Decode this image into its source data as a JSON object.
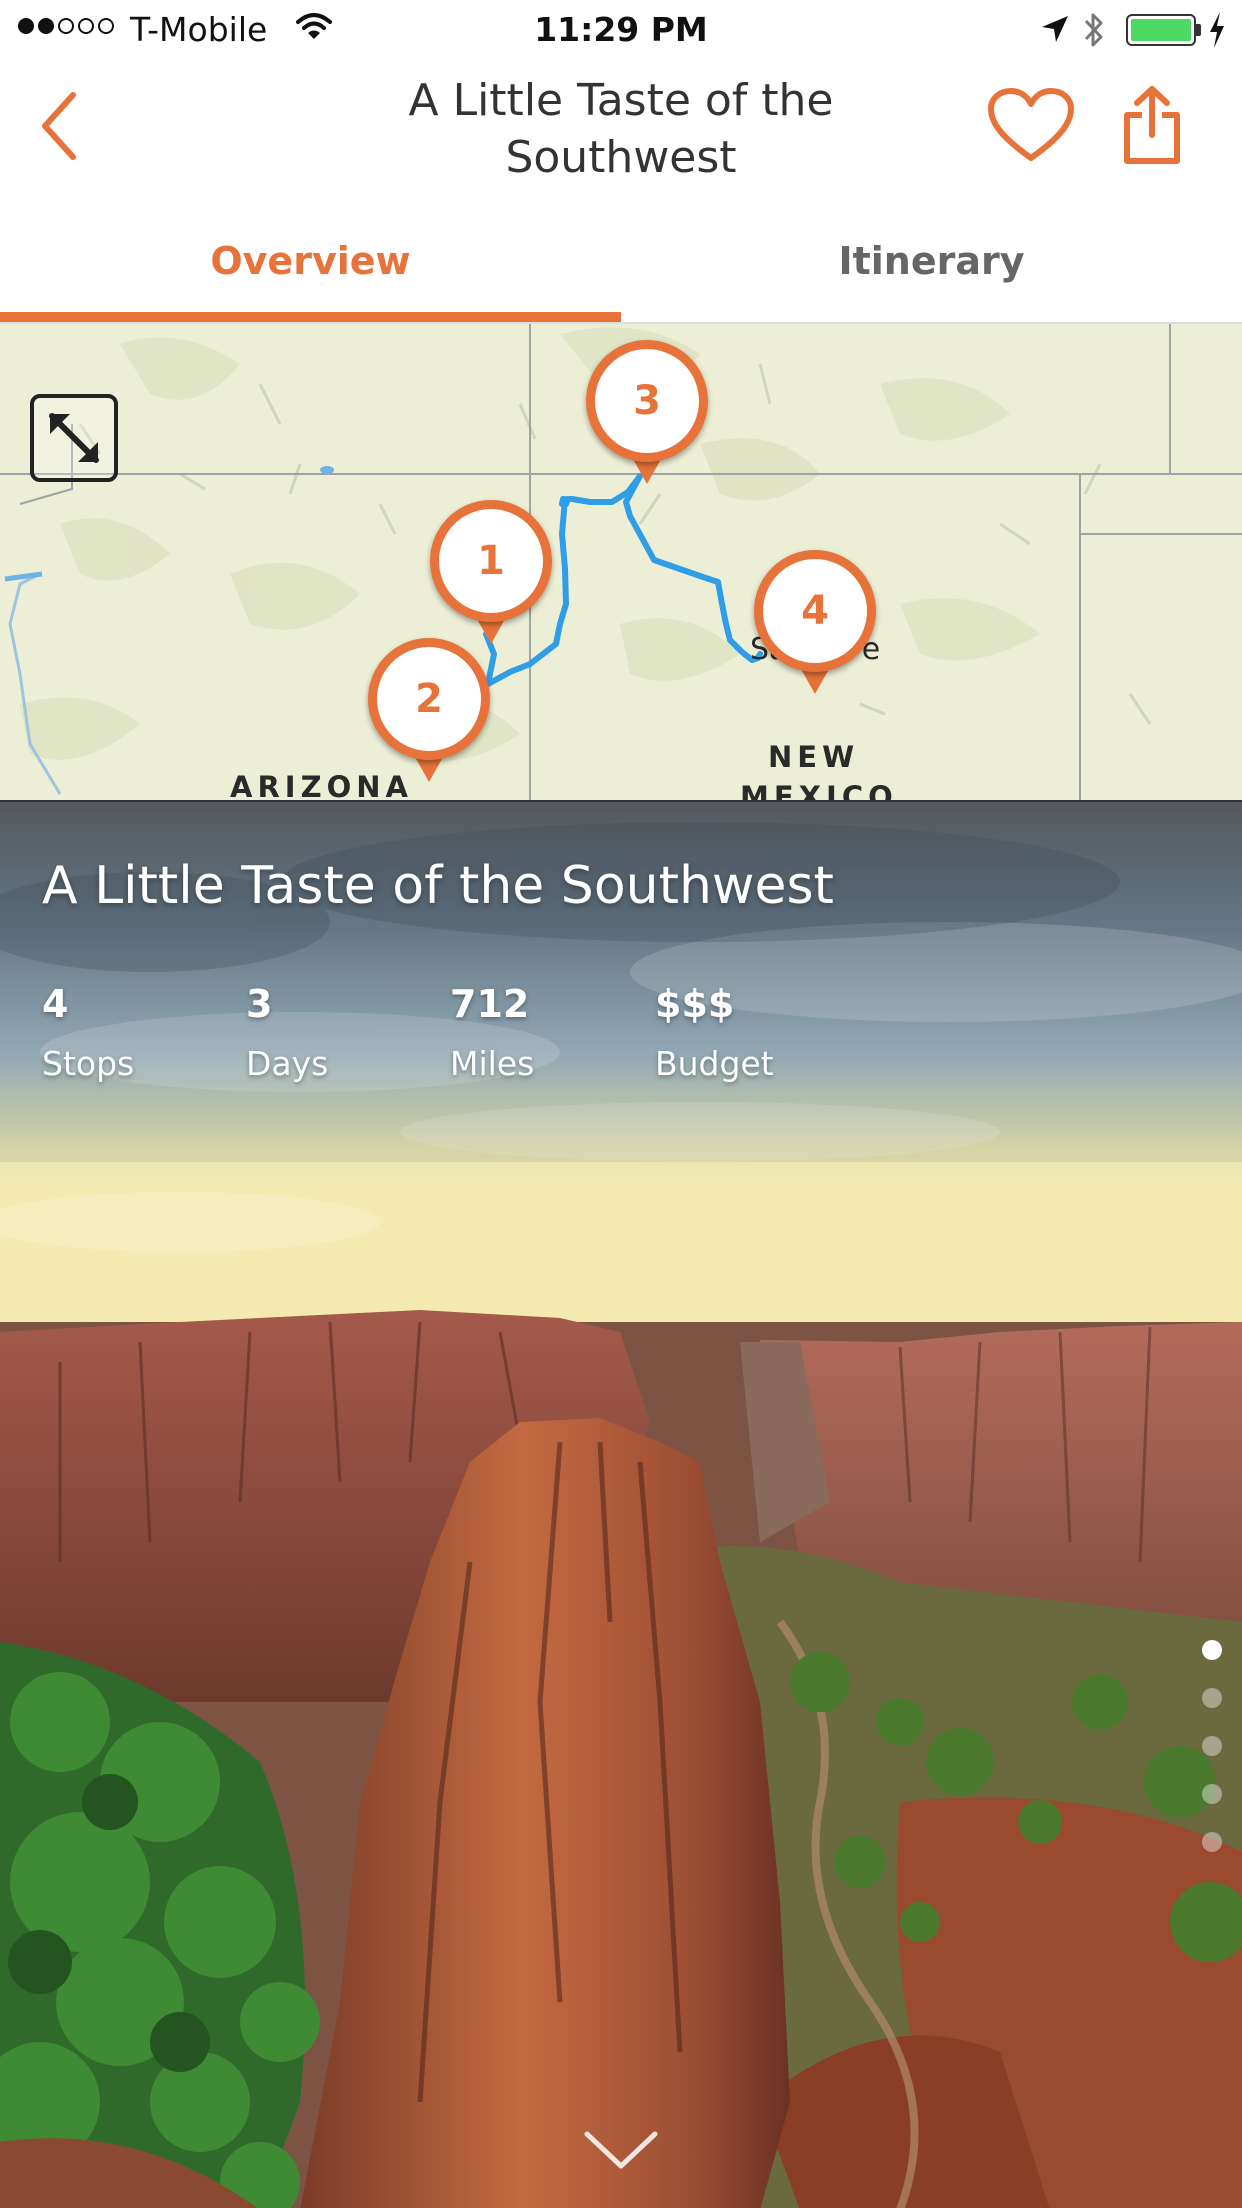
{
  "status_bar": {
    "carrier": "T-Mobile",
    "time": "11:29 PM",
    "signal_dots_filled": 2,
    "signal_dots_total": 5,
    "battery_level": 1.0
  },
  "nav": {
    "title": "A Little Taste of the Southwest",
    "back_icon": "chevron-left-icon",
    "favorite_icon": "heart-icon",
    "share_icon": "share-icon"
  },
  "tabs": [
    {
      "label": "Overview",
      "active": true
    },
    {
      "label": "Itinerary",
      "active": false
    }
  ],
  "map": {
    "labels": [
      "ARIZONA",
      "NEW",
      "MEXICO",
      "Santa Fe"
    ],
    "stops": [
      "1",
      "2",
      "3",
      "4"
    ],
    "route_color": "#2f9ee6",
    "expand_icon": "expand-icon"
  },
  "trip": {
    "title": "A Little Taste of the Southwest",
    "stats": [
      {
        "value": "4",
        "label": "Stops"
      },
      {
        "value": "3",
        "label": "Days"
      },
      {
        "value": "712",
        "label": "Miles"
      },
      {
        "value": "$$$",
        "label": "Budget"
      }
    ],
    "photo_count": 5,
    "active_photo": 1
  },
  "colors": {
    "accent": "#e8733a",
    "tab_inactive": "#666666",
    "map_background": "#eceed6"
  }
}
